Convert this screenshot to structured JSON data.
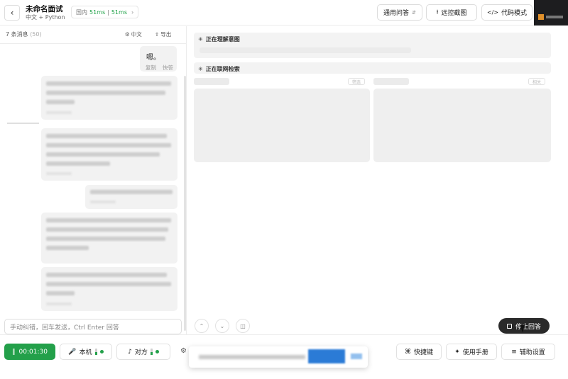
{
  "header": {
    "back_icon": "chevron-left-icon",
    "title": "未命名面试",
    "subtitle": "中文 + Python",
    "ping_region": "国内",
    "ping_a": "51ms",
    "ping_sep": "|",
    "ping_b": "51ms",
    "mode_select": "通用问答",
    "remote_screenshot": "远控截图",
    "code_mode": "代码模式"
  },
  "left": {
    "msg_count_label": "7 条消息",
    "msg_count_num": "(50)",
    "lang_btn": "中文",
    "export_btn": "导出",
    "bubble_text": "嗯。",
    "copy": "复制",
    "shortcut": "快答",
    "input_placeholder": "手动纠错，回车发送，Ctrl Enter 回答"
  },
  "right": {
    "section1_label": "正在理解意图",
    "section2_label": "正在联网检索",
    "tag_left": "筛选",
    "tag_right": "相关",
    "stop_button": "停止回答"
  },
  "footer": {
    "timer": "00:01:30",
    "mic_label": "本机",
    "peer_label": "对方",
    "hotkeys": "快捷键",
    "manual": "使用手册",
    "assist_settings": "辅助设置"
  },
  "colors": {
    "accent_green": "#23a04a",
    "dark_button": "#2a2a2a",
    "popup_blue": "#2b7bd6"
  }
}
